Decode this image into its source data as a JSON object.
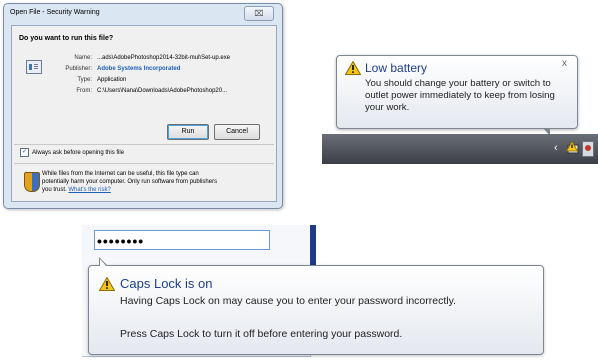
{
  "security_dialog": {
    "title": "Open File - Security Warning",
    "close_glyph": "⌧",
    "question": "Do you want to run this file?",
    "fields": [
      {
        "key": "Name:",
        "value": "...ads\\AdobePhotoshop2014-32bit-mul\\Set-up.exe"
      },
      {
        "key": "Publisher:",
        "value": "Adobe Systems Incorporated"
      },
      {
        "key": "Type:",
        "value": "Application"
      },
      {
        "key": "From:",
        "value": "C:\\Users\\Nana\\Downloads\\AdobePhotoshop20..."
      }
    ],
    "run_label": "Run",
    "cancel_label": "Cancel",
    "checkbox_label": "Always ask before opening this file",
    "checkbox_checked": true,
    "checkbox_glyph": "✓",
    "info_line1": "While files from the Internet can be useful, this file type can",
    "info_line2": "potentially harm your computer. Only run software from publishers",
    "info_line3_prefix": "you trust. ",
    "info_link": "What's the risk?",
    "icon_names": [
      "application-file-icon",
      "shield-icon"
    ]
  },
  "low_battery": {
    "title": "Low battery",
    "message_line1": "You should change your battery or switch to",
    "message_line2": "outlet power immediately to keep from losing",
    "message_line3": "your work.",
    "close_glyph": "x",
    "chevron_glyph": "‹",
    "warning_color": "#f5c518"
  },
  "caps_lock": {
    "password_mask": "••••••••",
    "title": "Caps Lock is on",
    "message_line1": "Having Caps Lock on may cause you to enter your password incorrectly.",
    "message_line2": "Press Caps Lock to turn it off before entering your password.",
    "title_color": "#1f3d8c"
  }
}
